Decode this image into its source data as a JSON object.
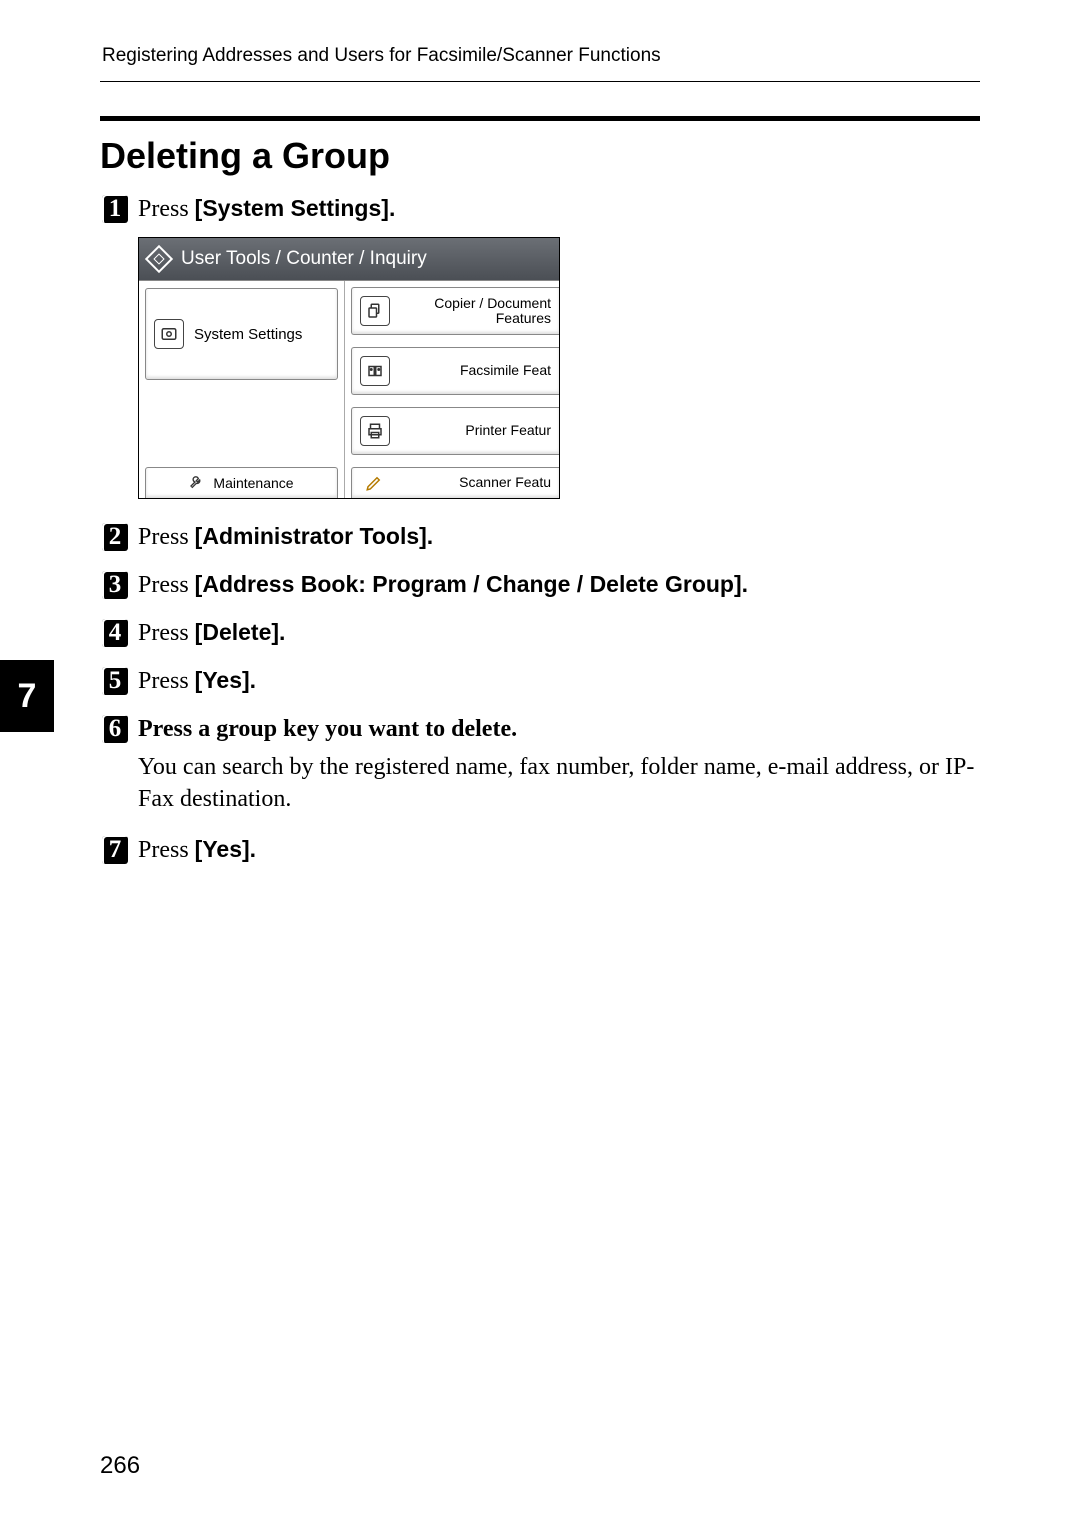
{
  "header": {
    "running": "Registering Addresses and Users for Facsimile/Scanner Functions"
  },
  "title": "Deleting a Group",
  "side_tab": "7",
  "page_number": "266",
  "steps": [
    {
      "n": "1",
      "prefix": "Press ",
      "bold": "[System Settings]",
      "suffix": "."
    },
    {
      "n": "2",
      "prefix": "Press ",
      "bold": "[Administrator Tools]",
      "suffix": "."
    },
    {
      "n": "3",
      "prefix": "Press ",
      "bold": "[Address Book: Program / Change / Delete Group]",
      "suffix": "."
    },
    {
      "n": "4",
      "prefix": "Press ",
      "bold": "[Delete]",
      "suffix": "."
    },
    {
      "n": "5",
      "prefix": "Press ",
      "bold": "[Yes]",
      "suffix": "."
    },
    {
      "n": "6",
      "bold_full": "Press a group key you want to delete.",
      "body": "You can search by the registered name, fax number, folder name, e-mail address, or IP-Fax destination."
    },
    {
      "n": "7",
      "prefix": "Press ",
      "bold": "[Yes]",
      "suffix": "."
    }
  ],
  "screenshot": {
    "title": "User Tools / Counter / Inquiry",
    "left_system": "System Settings",
    "left_maint": "Maintenance",
    "right": [
      "Copier / Document Features",
      "Facsimile Feat",
      "Printer Featur",
      "Scanner Featu"
    ]
  }
}
